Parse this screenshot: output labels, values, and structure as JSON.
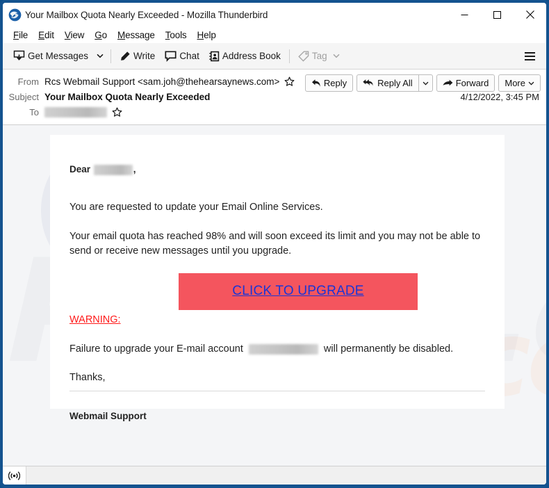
{
  "window": {
    "title": "Your Mailbox Quota Nearly Exceeded - Mozilla Thunderbird",
    "logo_icon": "thunderbird-logo-icon",
    "controls": {
      "minimize": "minimize-icon",
      "maximize": "maximize-icon",
      "close": "close-icon"
    },
    "border_color": "#14538f"
  },
  "menubar": {
    "items": [
      {
        "label": "File",
        "accesskey": "F"
      },
      {
        "label": "Edit",
        "accesskey": "E"
      },
      {
        "label": "View",
        "accesskey": "V"
      },
      {
        "label": "Go",
        "accesskey": "G"
      },
      {
        "label": "Message",
        "accesskey": "M"
      },
      {
        "label": "Tools",
        "accesskey": "T"
      },
      {
        "label": "Help",
        "accesskey": "H"
      }
    ]
  },
  "toolbar": {
    "get_messages_label": "Get Messages",
    "get_messages_icon": "get-messages-icon",
    "get_messages_caret_icon": "chevron-down-icon",
    "write_label": "Write",
    "write_icon": "pencil-icon",
    "chat_label": "Chat",
    "chat_icon": "chat-bubble-icon",
    "address_book_label": "Address Book",
    "address_book_icon": "address-book-icon",
    "tag_label": "Tag",
    "tag_icon": "tag-icon",
    "tag_caret_icon": "chevron-down-icon",
    "tag_disabled": true,
    "app_menu_icon": "hamburger-menu-icon"
  },
  "message_header": {
    "from_label": "From",
    "from_value": "Rcs Webmail Support <sam.joh@thehearsaynews.com>",
    "from_star_icon": "star-outline-icon",
    "subject_label": "Subject",
    "subject_value": "Your Mailbox Quota Nearly Exceeded",
    "to_label": "To",
    "to_value": "",
    "to_redacted": true,
    "to_star_icon": "star-outline-icon",
    "date": "4/12/2022, 3:45 PM",
    "actions": {
      "reply_label": "Reply",
      "reply_icon": "reply-arrow-icon",
      "reply_all_label": "Reply All",
      "reply_all_icon": "reply-all-arrow-icon",
      "reply_all_caret_icon": "chevron-down-icon",
      "forward_label": "Forward",
      "forward_icon": "forward-arrow-icon",
      "more_label": "More",
      "more_caret_icon": "chevron-down-icon"
    }
  },
  "email": {
    "greeting_prefix": "Dear",
    "greeting_redacted": true,
    "greeting_suffix": ",",
    "paragraph_1": "You are requested to update your Email Online Services.",
    "paragraph_2": "Your email quota has reached 98% and will soon exceed its limit and you may not be able to send or receive new messages until you upgrade.",
    "cta_label": "CLICK TO UPGRADE",
    "cta_bg_color": "#f4555e",
    "cta_link_color": "#1a35d6",
    "warning_label": "WARNING:",
    "warning_color": "#ff1a1a",
    "failure_prefix": "Failure to upgrade your E-mail account",
    "failure_redacted": true,
    "failure_suffix": "will permanently be disabled.",
    "thanks": "Thanks,",
    "signoff": "Webmail Support",
    "watermark_text": "PCrisk.com",
    "watermark_text_2": "risk.com"
  },
  "statusbar": {
    "rss_icon": "rss-broadcast-icon",
    "text": ""
  }
}
